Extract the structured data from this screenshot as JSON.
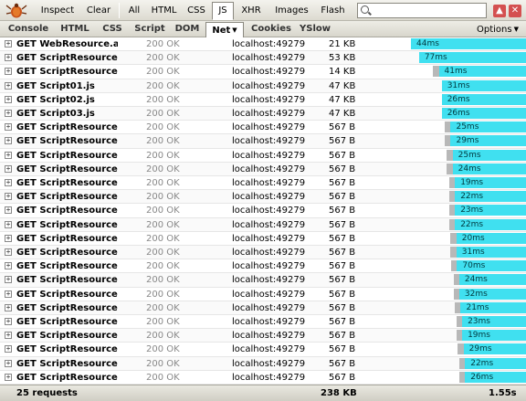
{
  "toolbar": {
    "inspect": "Inspect",
    "clear": "Clear",
    "filters": [
      "All",
      "HTML",
      "CSS",
      "JS",
      "XHR",
      "Images",
      "Flash"
    ],
    "active_filter": "JS",
    "search_value": "",
    "search_icon": "search-icon",
    "close_icon": "close-icon"
  },
  "panels": {
    "tabs": [
      "Console",
      "HTML",
      "CSS",
      "Script",
      "DOM",
      "Net",
      "Cookies",
      "YSlow"
    ],
    "active": "Net",
    "options": "Options"
  },
  "requests": [
    {
      "url": "GET WebResource.axd",
      "status": "200 OK",
      "domain": "localhost:49279",
      "size": "21 KB",
      "time": "44ms",
      "start": 0.0,
      "wait": 0.0
    },
    {
      "url": "GET ScriptResource.axd",
      "status": "200 OK",
      "domain": "localhost:49279",
      "size": "53 KB",
      "time": "77ms",
      "start": 0.028,
      "wait": 0.0
    },
    {
      "url": "GET ScriptResource.axd",
      "status": "200 OK",
      "domain": "localhost:49279",
      "size": "14 KB",
      "time": "41ms",
      "start": 0.077,
      "wait": 0.02
    },
    {
      "url": "GET Script01.js",
      "status": "200 OK",
      "domain": "localhost:49279",
      "size": "47 KB",
      "time": "31ms",
      "start": 0.107,
      "wait": 0.0
    },
    {
      "url": "GET Script02.js",
      "status": "200 OK",
      "domain": "localhost:49279",
      "size": "47 KB",
      "time": "26ms",
      "start": 0.107,
      "wait": 0.0
    },
    {
      "url": "GET Script03.js",
      "status": "200 OK",
      "domain": "localhost:49279",
      "size": "47 KB",
      "time": "26ms",
      "start": 0.107,
      "wait": 0.0
    },
    {
      "url": "GET ScriptResource.axd",
      "status": "200 OK",
      "domain": "localhost:49279",
      "size": "567 B",
      "time": "25ms",
      "start": 0.118,
      "wait": 0.02
    },
    {
      "url": "GET ScriptResource.axd",
      "status": "200 OK",
      "domain": "localhost:49279",
      "size": "567 B",
      "time": "29ms",
      "start": 0.118,
      "wait": 0.02
    },
    {
      "url": "GET ScriptResource.axd",
      "status": "200 OK",
      "domain": "localhost:49279",
      "size": "567 B",
      "time": "25ms",
      "start": 0.125,
      "wait": 0.02
    },
    {
      "url": "GET ScriptResource.axd",
      "status": "200 OK",
      "domain": "localhost:49279",
      "size": "567 B",
      "time": "24ms",
      "start": 0.125,
      "wait": 0.02
    },
    {
      "url": "GET ScriptResource.axd",
      "status": "200 OK",
      "domain": "localhost:49279",
      "size": "567 B",
      "time": "19ms",
      "start": 0.133,
      "wait": 0.02
    },
    {
      "url": "GET ScriptResource.axd",
      "status": "200 OK",
      "domain": "localhost:49279",
      "size": "567 B",
      "time": "22ms",
      "start": 0.133,
      "wait": 0.02
    },
    {
      "url": "GET ScriptResource.axd",
      "status": "200 OK",
      "domain": "localhost:49279",
      "size": "567 B",
      "time": "23ms",
      "start": 0.133,
      "wait": 0.02
    },
    {
      "url": "GET ScriptResource.axd",
      "status": "200 OK",
      "domain": "localhost:49279",
      "size": "567 B",
      "time": "22ms",
      "start": 0.133,
      "wait": 0.02
    },
    {
      "url": "GET ScriptResource.axd",
      "status": "200 OK",
      "domain": "localhost:49279",
      "size": "567 B",
      "time": "20ms",
      "start": 0.138,
      "wait": 0.02
    },
    {
      "url": "GET ScriptResource.axd",
      "status": "200 OK",
      "domain": "localhost:49279",
      "size": "567 B",
      "time": "31ms",
      "start": 0.138,
      "wait": 0.02
    },
    {
      "url": "GET ScriptResource.axd",
      "status": "200 OK",
      "domain": "localhost:49279",
      "size": "567 B",
      "time": "70ms",
      "start": 0.14,
      "wait": 0.02
    },
    {
      "url": "GET ScriptResource.axd",
      "status": "200 OK",
      "domain": "localhost:49279",
      "size": "567 B",
      "time": "24ms",
      "start": 0.148,
      "wait": 0.02
    },
    {
      "url": "GET ScriptResource.axd",
      "status": "200 OK",
      "domain": "localhost:49279",
      "size": "567 B",
      "time": "32ms",
      "start": 0.148,
      "wait": 0.02
    },
    {
      "url": "GET ScriptResource.axd",
      "status": "200 OK",
      "domain": "localhost:49279",
      "size": "567 B",
      "time": "21ms",
      "start": 0.153,
      "wait": 0.02
    },
    {
      "url": "GET ScriptResource.axd",
      "status": "200 OK",
      "domain": "localhost:49279",
      "size": "567 B",
      "time": "23ms",
      "start": 0.158,
      "wait": 0.02
    },
    {
      "url": "GET ScriptResource.axd",
      "status": "200 OK",
      "domain": "localhost:49279",
      "size": "567 B",
      "time": "19ms",
      "start": 0.158,
      "wait": 0.02
    },
    {
      "url": "GET ScriptResource.axd",
      "status": "200 OK",
      "domain": "localhost:49279",
      "size": "567 B",
      "time": "29ms",
      "start": 0.163,
      "wait": 0.02
    },
    {
      "url": "GET ScriptResource.axd",
      "status": "200 OK",
      "domain": "localhost:49279",
      "size": "567 B",
      "time": "22ms",
      "start": 0.168,
      "wait": 0.02
    },
    {
      "url": "GET ScriptResource.axd",
      "status": "200 OK",
      "domain": "localhost:49279",
      "size": "567 B",
      "time": "26ms",
      "start": 0.168,
      "wait": 0.02
    }
  ],
  "summary": {
    "count": "25 requests",
    "size": "238 KB",
    "time": "1.55s"
  },
  "colors": {
    "bar": "#40e0f0",
    "bar_wait": "#b8b8b8",
    "status_text": "#888888"
  }
}
